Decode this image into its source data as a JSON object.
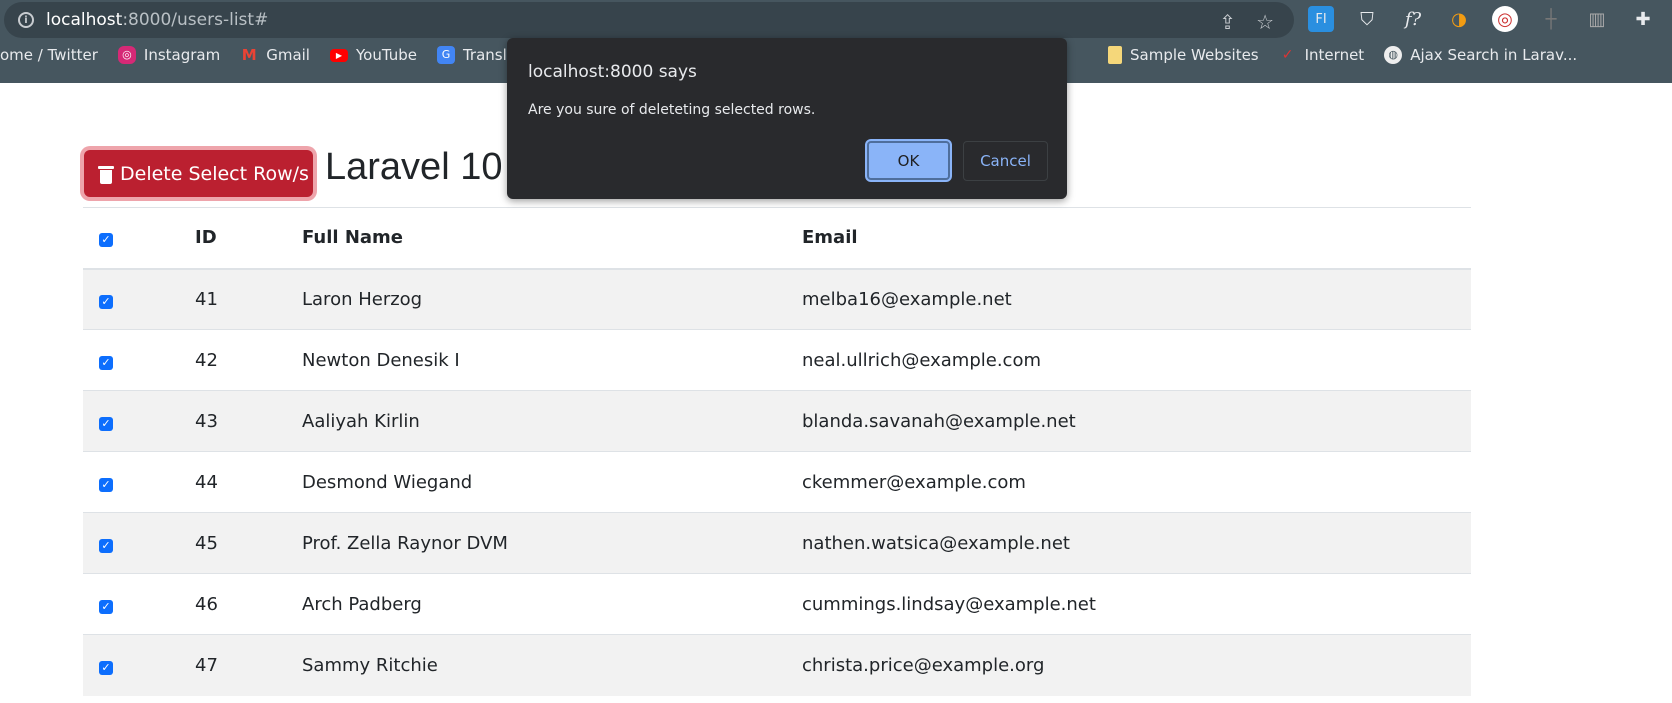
{
  "browser": {
    "url_host": "localhost",
    "url_rest": ":8000/users-list#",
    "bookmarks": [
      {
        "label": "ome / Twitter",
        "icon": "none"
      },
      {
        "label": "Instagram",
        "icon": "instagram-icon",
        "color": "#d62976"
      },
      {
        "label": "Gmail",
        "icon": "gmail-icon",
        "color": "#ea4335"
      },
      {
        "label": "YouTube",
        "icon": "youtube-icon",
        "color": "#ff0000"
      },
      {
        "label": "Translate",
        "icon": "translate-icon",
        "color": "#4285f4"
      }
    ],
    "bookmarks_right": [
      {
        "label": "Sample Websites",
        "icon": "folder-icon",
        "color": "#f5d77a"
      },
      {
        "label": "Internet",
        "icon": "checkbox-icon",
        "color": "#555"
      },
      {
        "label": "Ajax Search in Larav...",
        "icon": "globe-icon",
        "color": "#ddd"
      }
    ]
  },
  "page": {
    "delete_button": "Delete Select Row/s",
    "heading": "Laravel 10",
    "table": {
      "headers": [
        "ID",
        "Full Name",
        "Email"
      ],
      "rows": [
        {
          "id": "41",
          "name": "Laron Herzog",
          "email": "melba16@example.net",
          "checked": true
        },
        {
          "id": "42",
          "name": "Newton Denesik I",
          "email": "neal.ullrich@example.com",
          "checked": true
        },
        {
          "id": "43",
          "name": "Aaliyah Kirlin",
          "email": "blanda.savanah@example.net",
          "checked": true
        },
        {
          "id": "44",
          "name": "Desmond Wiegand",
          "email": "ckemmer@example.com",
          "checked": true
        },
        {
          "id": "45",
          "name": "Prof. Zella Raynor DVM",
          "email": "nathen.watsica@example.net",
          "checked": true
        },
        {
          "id": "46",
          "name": "Arch Padberg",
          "email": "cummings.lindsay@example.net",
          "checked": true
        },
        {
          "id": "47",
          "name": "Sammy Ritchie",
          "email": "christa.price@example.org",
          "checked": true
        }
      ]
    }
  },
  "dialog": {
    "title": "localhost:8000 says",
    "message": "Are you sure of deleteting selected rows.",
    "ok": "OK",
    "cancel": "Cancel"
  }
}
